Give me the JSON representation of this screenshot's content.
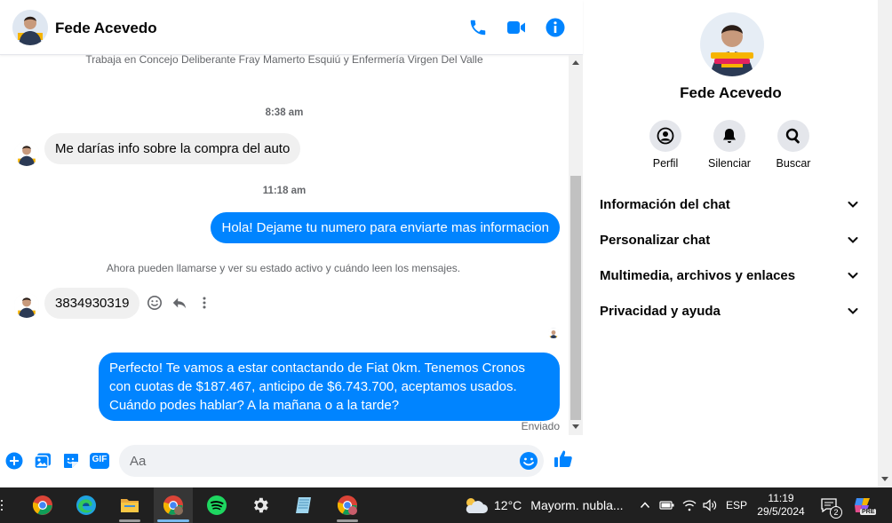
{
  "contact": {
    "name": "Fede Acevedo"
  },
  "messages": {
    "bio_line": "Trabaja en Concejo Deliberante Fray Mamerto Esquiú y Enfermería Virgen Del Valle",
    "time1": "8:38 am",
    "incoming1": "Me darías info sobre la compra del auto",
    "time2": "11:18 am",
    "outgoing1": "Hola! Dejame tu numero para enviarte mas informacion",
    "notice": "Ahora pueden llamarse y ver su estado activo y cuándo leen los mensajes.",
    "incoming2": "3834930319",
    "outgoing2": "Perfecto! Te vamos a estar contactando de Fiat 0km. Tenemos Cronos con cuotas de $187.467, anticipo de $6.743.700, aceptamos usados. Cuándo podes hablar? A la mañana o a la tarde?",
    "status": "Enviado"
  },
  "composer": {
    "placeholder": "Aa",
    "gif_label": "GIF"
  },
  "panel": {
    "actions": [
      {
        "label": "Perfil",
        "icon": "profile-icon"
      },
      {
        "label": "Silenciar",
        "icon": "bell-icon"
      },
      {
        "label": "Buscar",
        "icon": "search-icon"
      }
    ],
    "sections": [
      {
        "label": "Información del chat"
      },
      {
        "label": "Personalizar chat"
      },
      {
        "label": "Multimedia, archivos y enlaces"
      },
      {
        "label": "Privacidad y ayuda"
      }
    ]
  },
  "taskbar": {
    "weather": {
      "temp": "12°C",
      "desc": "Mayorm. nubla..."
    },
    "lang": "ESP",
    "time": "11:19",
    "date": "29/5/2024",
    "notifications": "2",
    "copilot_badge": "PRE"
  },
  "colors": {
    "accent": "#0084ff",
    "incoming_bubble": "#f0f0f0",
    "taskbar": "#202020"
  }
}
